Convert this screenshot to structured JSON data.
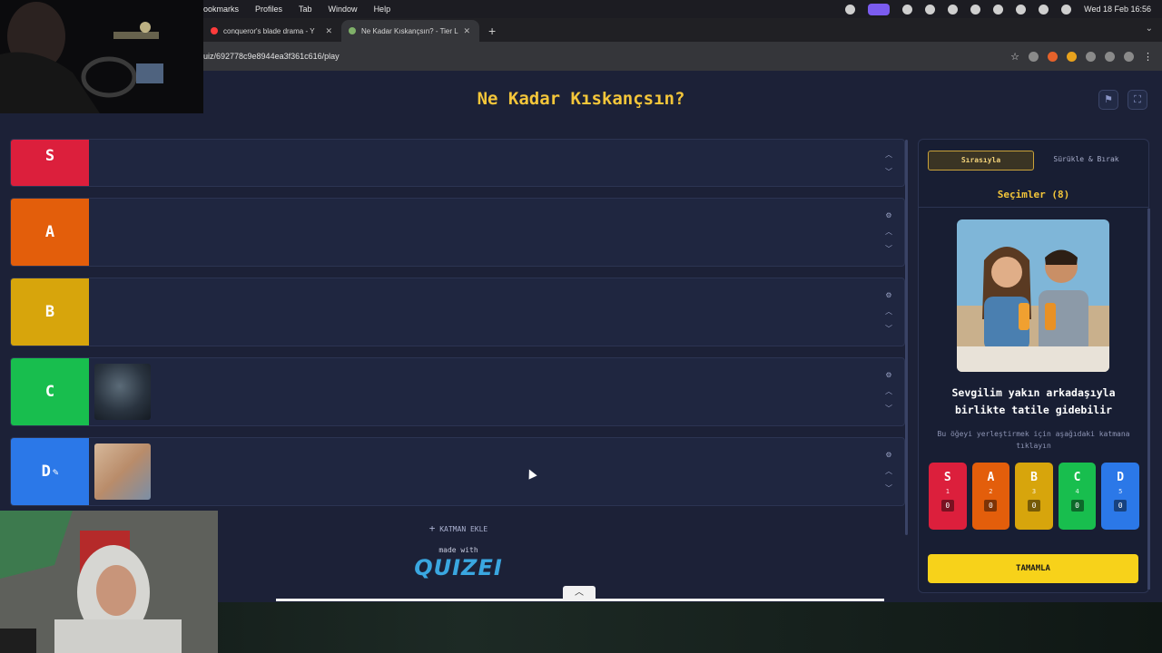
{
  "menubar": {
    "items": [
      "ookmarks",
      "Profiles",
      "Tab",
      "Window",
      "Help"
    ],
    "datetime": "Wed 18 Feb 16:56"
  },
  "tabs": [
    {
      "title": "conqueror's blade drama - Y",
      "favicon_color": "#ff3b3b"
    },
    {
      "title": "Ne Kadar Kıskançsın? - Tier L",
      "favicon_color": "#7fb069"
    }
  ],
  "address": {
    "url": "uiz/692778c9e8944ea3f361c616/play"
  },
  "page": {
    "title": "Ne Kadar Kıskançsın?"
  },
  "tiers": [
    {
      "label": "S",
      "color": "#dc1f3c",
      "items": 0
    },
    {
      "label": "A",
      "color": "#e35e0b",
      "items": 0
    },
    {
      "label": "B",
      "color": "#d7a50c",
      "items": 0
    },
    {
      "label": "C",
      "color": "#18be4e",
      "items": 1
    },
    {
      "label": "D",
      "color": "#2b78e8",
      "items": 1,
      "editing": true
    }
  ],
  "add_layer": {
    "label": "KATMAN EKLE"
  },
  "footer": {
    "made_with": "made with",
    "brand": "QUIZEI"
  },
  "panel": {
    "tabs": [
      {
        "label": "Sırasıyla",
        "active": true
      },
      {
        "label": "Sürükle & Bırak",
        "active": false
      }
    ],
    "selection_title": "Seçimler (8)",
    "card_text": "Sevgilim yakın arkadaşıyla birlikte tatile gidebilir",
    "hint": "Bu öğeyi yerleştirmek için aşağıdaki katmana tıklayın",
    "tier_buttons": [
      {
        "label": "S",
        "number": "1",
        "count": "0",
        "color": "#dc1f3c"
      },
      {
        "label": "A",
        "number": "2",
        "count": "0",
        "color": "#e35e0b"
      },
      {
        "label": "B",
        "number": "3",
        "count": "0",
        "color": "#d7a50c"
      },
      {
        "label": "C",
        "number": "4",
        "count": "0",
        "color": "#18be4e"
      },
      {
        "label": "D",
        "number": "5",
        "count": "0",
        "color": "#2b78e8"
      }
    ],
    "done": "TAMAMLA"
  },
  "icons": [
    "gear-icon",
    "chevron-up-icon",
    "chevron-down-icon",
    "flag-icon",
    "fullscreen-icon",
    "pencil-icon",
    "plus-icon",
    "star-icon",
    "close-icon"
  ]
}
